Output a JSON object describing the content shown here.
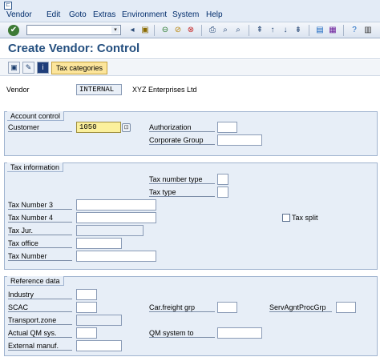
{
  "menubar": {
    "items": [
      "Vendor",
      "Edit",
      "Goto",
      "Extras",
      "Environment",
      "System",
      "Help"
    ]
  },
  "toolbar": {
    "command_field": "",
    "icons": [
      "enter-icon",
      "back-icon",
      "exit-icon",
      "cancel-icon",
      "print-icon",
      "find-icon",
      "find-next-icon",
      "first-page-icon",
      "prev-page-icon",
      "next-page-icon",
      "last-page-icon",
      "new-session-icon",
      "shortcut-icon",
      "help-icon",
      "layout-icon"
    ]
  },
  "title": "Create Vendor: Control",
  "app_toolbar": {
    "tax_categories_label": "Tax categories"
  },
  "header": {
    "vendor_label": "Vendor",
    "vendor_value": "INTERNAL",
    "vendor_name": "XYZ Enterprises Ltd"
  },
  "account_control": {
    "title": "Account control",
    "customer_label": "Customer",
    "customer_value": "1050",
    "authorization_label": "Authorization",
    "authorization_value": "",
    "corporate_group_label": "Corporate Group",
    "corporate_group_value": ""
  },
  "tax_information": {
    "title": "Tax information",
    "tax_number_type_label": "Tax number type",
    "tax_type_label": "Tax type",
    "tax_number_3_label": "Tax Number 3",
    "tax_number_4_label": "Tax Number 4",
    "tax_jur_label": "Tax Jur.",
    "tax_office_label": "Tax office",
    "tax_number_label": "Tax Number",
    "tax_split_label": "Tax split",
    "tax_split_checked": false
  },
  "reference_data": {
    "title": "Reference data",
    "industry_label": "Industry",
    "scac_label": "SCAC",
    "transport_zone_label": "Transport.zone",
    "actual_qm_label": "Actual QM sys.",
    "external_manuf_label": "External manuf.",
    "car_freight_label": "Car.freight grp",
    "qm_system_to_label": "QM system to",
    "serv_agnt_label": "ServAgntProcGrp"
  }
}
